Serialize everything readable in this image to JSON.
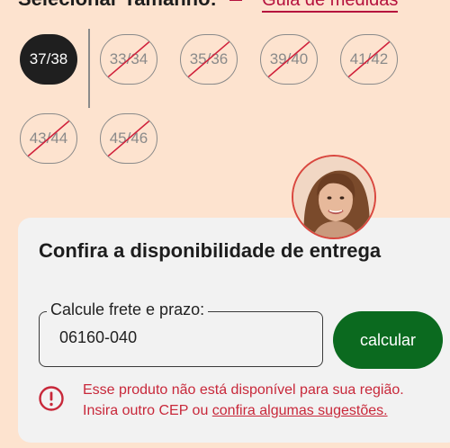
{
  "header": {
    "title_partial": "Selecionar Tamanho:",
    "guide_link": "Guia de medidas"
  },
  "sizes": [
    {
      "label": "37/38",
      "state": "selected"
    },
    {
      "label": "33/34",
      "state": "unavailable"
    },
    {
      "label": "35/36",
      "state": "unavailable"
    },
    {
      "label": "39/40",
      "state": "unavailable"
    },
    {
      "label": "41/42",
      "state": "unavailable"
    },
    {
      "label": "43/44",
      "state": "unavailable"
    },
    {
      "label": "45/46",
      "state": "unavailable"
    }
  ],
  "delivery": {
    "title": "Confira a disponibilidade de entrega",
    "field_label": "Calcule frete e prazo:",
    "cep_value": "06160-040",
    "calculate_label": "calcular",
    "error_line1": "Esse produto não está disponível para sua região.",
    "error_line2_prefix": "Insira outro CEP ou ",
    "error_link": "confira algumas sugestões."
  },
  "colors": {
    "page_bg": "#fde3cf",
    "selected_pill": "#1f1f1f",
    "calculate_button": "#0b6a1f",
    "error": "#c8283a",
    "strike": "#d0213b"
  }
}
